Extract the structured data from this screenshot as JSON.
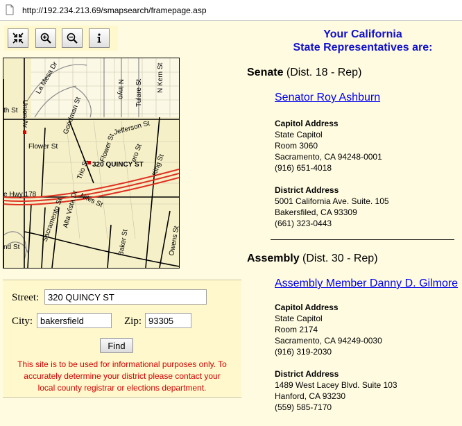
{
  "browser": {
    "url": "http://192.234.213.69/smapsearch/framepage.asp"
  },
  "toolbar": {
    "buttons": [
      {
        "name": "full-extent",
        "icon": "full-extent-icon"
      },
      {
        "name": "zoom-in",
        "icon": "zoom-in-icon"
      },
      {
        "name": "zoom-out",
        "icon": "zoom-out-icon"
      },
      {
        "name": "info",
        "icon": "info-icon"
      }
    ]
  },
  "map": {
    "street_labels": [
      "La Mesa Dr",
      "N Inyo",
      "Tulare St",
      "N Kern St",
      "th St",
      "Union Av",
      "Goodman St",
      "Jefferson St",
      "Flower St",
      "Trio St",
      "Flower St",
      "ero St",
      "King St",
      "320 QUINCY ST",
      "e Hwy 178",
      "Niles St",
      "Sacramento St",
      "Alta Vista Dr",
      "Baker St",
      "Owens St",
      "nd St"
    ],
    "marker_label": "320 QUINCY ST"
  },
  "form": {
    "street_label": "Street:",
    "street_value": "320 QUINCY ST",
    "city_label": "City:",
    "city_value": "bakersfield",
    "zip_label": "Zip:",
    "zip_value": "93305",
    "find_label": "Find",
    "disclaimer_lines": [
      "This site is to be used for informational purposes only. To",
      "accurately determine your district please contact your",
      "local county registrar or elections department."
    ]
  },
  "results": {
    "heading_line1": "Your California",
    "heading_line2": "State Representatives are:",
    "senate": {
      "chamber": "Senate",
      "district": "(Dist. 18 - Rep)",
      "rep_name": "Senator Roy Ashburn",
      "capitol": {
        "title": "Capitol Address",
        "lines": [
          "State Capitol",
          "Room 3060",
          "Sacramento, CA 94248-0001",
          "(916) 651-4018"
        ]
      },
      "district_office": {
        "title": "District Address",
        "lines": [
          "5001 California Ave. Suite. 105",
          "Bakersfiled, CA 93309",
          "(661) 323-0443"
        ]
      }
    },
    "assembly": {
      "chamber": "Assembly",
      "district": "(Dist. 30 - Rep)",
      "rep_name": "Assembly Member Danny D. Gilmore",
      "capitol": {
        "title": "Capitol Address",
        "lines": [
          "State Capitol",
          "Room 2174",
          "Sacramento, CA 94249-0030",
          "(916) 319-2030"
        ]
      },
      "district_office": {
        "title": "District Address",
        "lines": [
          "1489 West Lacey Blvd. Suite 103",
          "Hanford, CA 93230",
          "(559) 585-7170"
        ]
      }
    }
  },
  "colors": {
    "background": "#fffbe1",
    "heading": "#1010cc",
    "link": "#0000ee",
    "disclaimer": "#d40000",
    "highway": "#e03020"
  }
}
